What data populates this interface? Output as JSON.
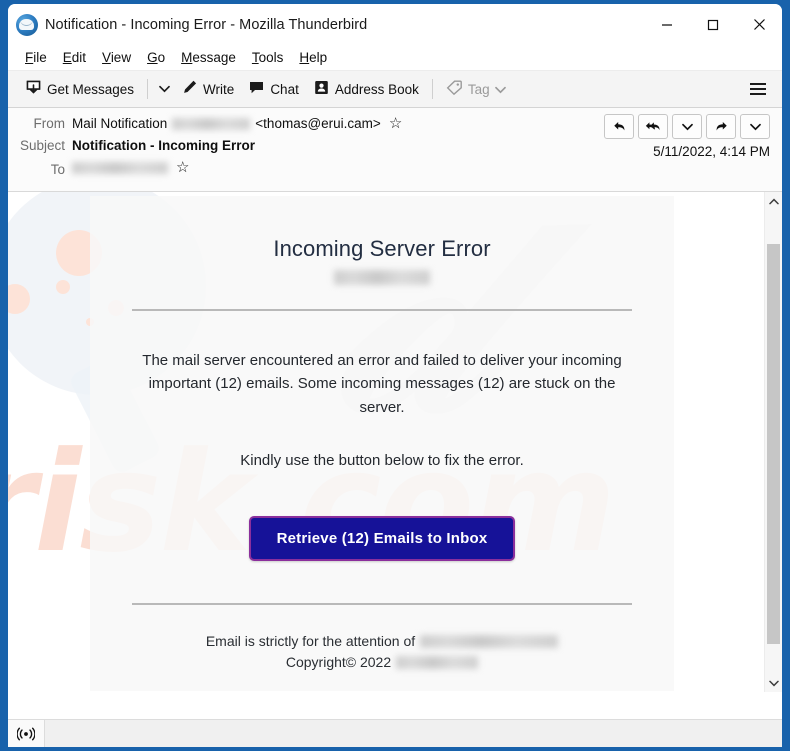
{
  "window": {
    "title": "Notification - Incoming Error - Mozilla Thunderbird",
    "app_icon": "thunderbird-logo-icon",
    "controls": {
      "minimize_label": "Minimize",
      "maximize_label": "Maximize",
      "close_label": "Close"
    },
    "frame_color": "#1862ab"
  },
  "menubar": {
    "items": [
      {
        "label": "File",
        "accel": "F"
      },
      {
        "label": "Edit",
        "accel": "E"
      },
      {
        "label": "View",
        "accel": "V"
      },
      {
        "label": "Go",
        "accel": "G"
      },
      {
        "label": "Message",
        "accel": "M"
      },
      {
        "label": "Tools",
        "accel": "T"
      },
      {
        "label": "Help",
        "accel": "H"
      }
    ]
  },
  "toolbar": {
    "get_messages_label": "Get Messages",
    "get_messages_icon": "download-inbox-icon",
    "get_messages_caret_icon": "chevron-down-icon",
    "write_label": "Write",
    "write_icon": "pencil-icon",
    "chat_label": "Chat",
    "chat_icon": "speech-bubble-icon",
    "address_book_label": "Address Book",
    "address_book_icon": "contact-card-icon",
    "tag_label": "Tag",
    "tag_icon": "tag-icon",
    "tag_caret_icon": "chevron-down-icon",
    "tag_disabled": true,
    "app_menu_icon": "hamburger-menu-icon"
  },
  "message_header": {
    "from_label": "From",
    "from_display_name": "Mail Notification",
    "from_redacted_text": "",
    "from_address": "<thomas@erui.cam>",
    "from_star_icon": "star-icon",
    "subject_label": "Subject",
    "subject_value": "Notification - Incoming Error",
    "to_label": "To",
    "to_redacted_text": "",
    "to_star_icon": "star-icon",
    "date": "5/11/2022, 4:14 PM",
    "actions": [
      {
        "name": "reply-button",
        "icon": "reply-arrow-icon"
      },
      {
        "name": "reply-all-button",
        "icon": "reply-all-arrow-icon"
      },
      {
        "name": "reply-options-button",
        "icon": "chevron-down-icon"
      },
      {
        "name": "forward-button",
        "icon": "forward-arrow-icon"
      },
      {
        "name": "more-options-button",
        "icon": "chevron-down-icon"
      }
    ]
  },
  "email": {
    "title": "Incoming Server Error",
    "domain_redacted": "",
    "paragraph_1": "The mail server encountered an error and failed to deliver your incoming important (12) emails. Some incoming messages (12) are stuck on the server.",
    "paragraph_2": "Kindly use the button below to fix the error.",
    "cta_label": "Retrieve (12) Emails to Inbox",
    "cta_bg": "#161298",
    "cta_border": "#8b2f9c",
    "footer_line_1_prefix": "Email is strictly for the attention of",
    "footer_line_1_redacted": "",
    "footer_line_2_prefix": "Copyright© 2022",
    "footer_line_2_redacted": "",
    "email_count": 12,
    "copyright_year": "2022",
    "watermark_text": "risk.com"
  },
  "scrollbar": {
    "up_arrow_icon": "chevron-up-icon",
    "down_arrow_icon": "chevron-down-icon",
    "thumb_label": "vertical-scroll-thumb"
  },
  "statusbar": {
    "icon": "broadcast-antenna-icon",
    "text": ""
  }
}
